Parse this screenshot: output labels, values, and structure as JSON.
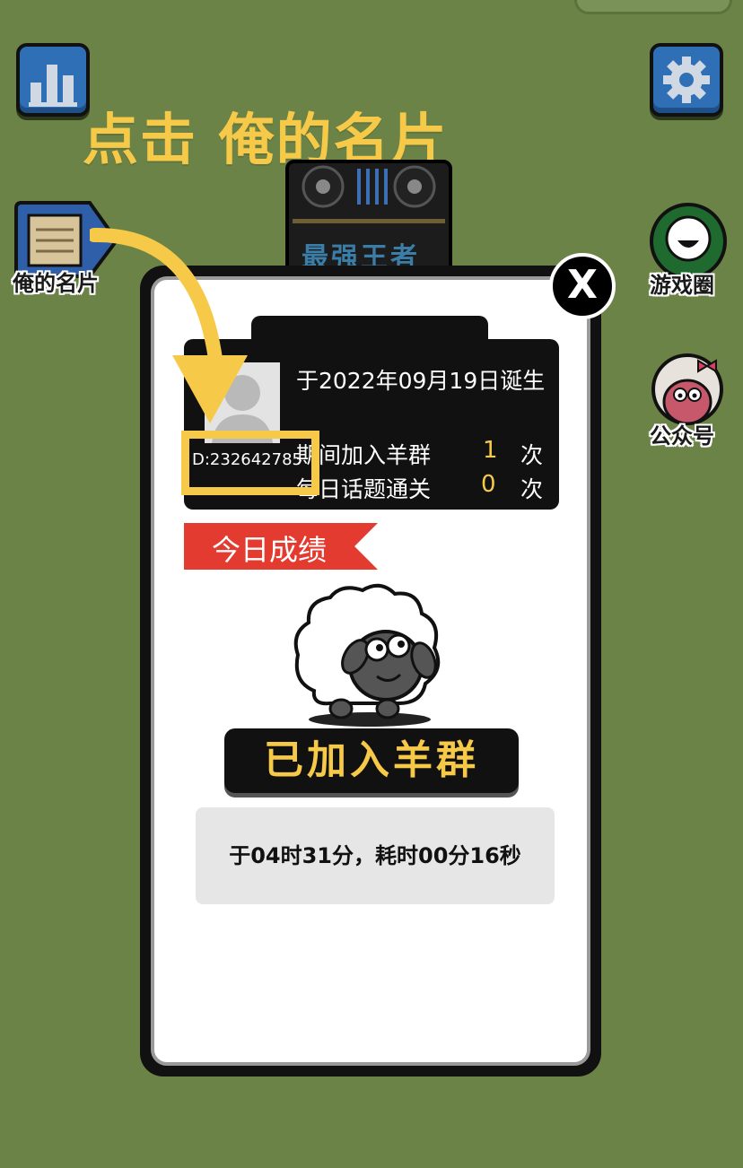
{
  "hint": {
    "text": "点击 俺的名片"
  },
  "side": {
    "my_card_label": "俺的名片",
    "game_circle_label": "游戏圈",
    "official_account_label": "公众号"
  },
  "dj": {
    "title": "最强王者"
  },
  "card": {
    "birth": "于2022年09月19日诞生",
    "joined_prefix": "期间加入羊群",
    "joined_count": "1",
    "times": "次",
    "daily_prefix": "每日话题通关",
    "daily_count": "0",
    "id": "D:232642785"
  },
  "today": {
    "ribbon": "今日成绩",
    "status": "已加入羊群",
    "time": "于04时31分，耗时00分16秒"
  },
  "close": "X",
  "colors": {
    "background": "#6b8346",
    "accent_yellow": "#f7c948",
    "ribbon_red": "#e33b2f",
    "button_blue": "#2f6fb5"
  },
  "icons": [
    "bar-chart-icon",
    "gear-icon",
    "name-card-icon",
    "chat-bubble-icon",
    "sheep-avatar-icon",
    "close-icon",
    "arrow-icon"
  ]
}
